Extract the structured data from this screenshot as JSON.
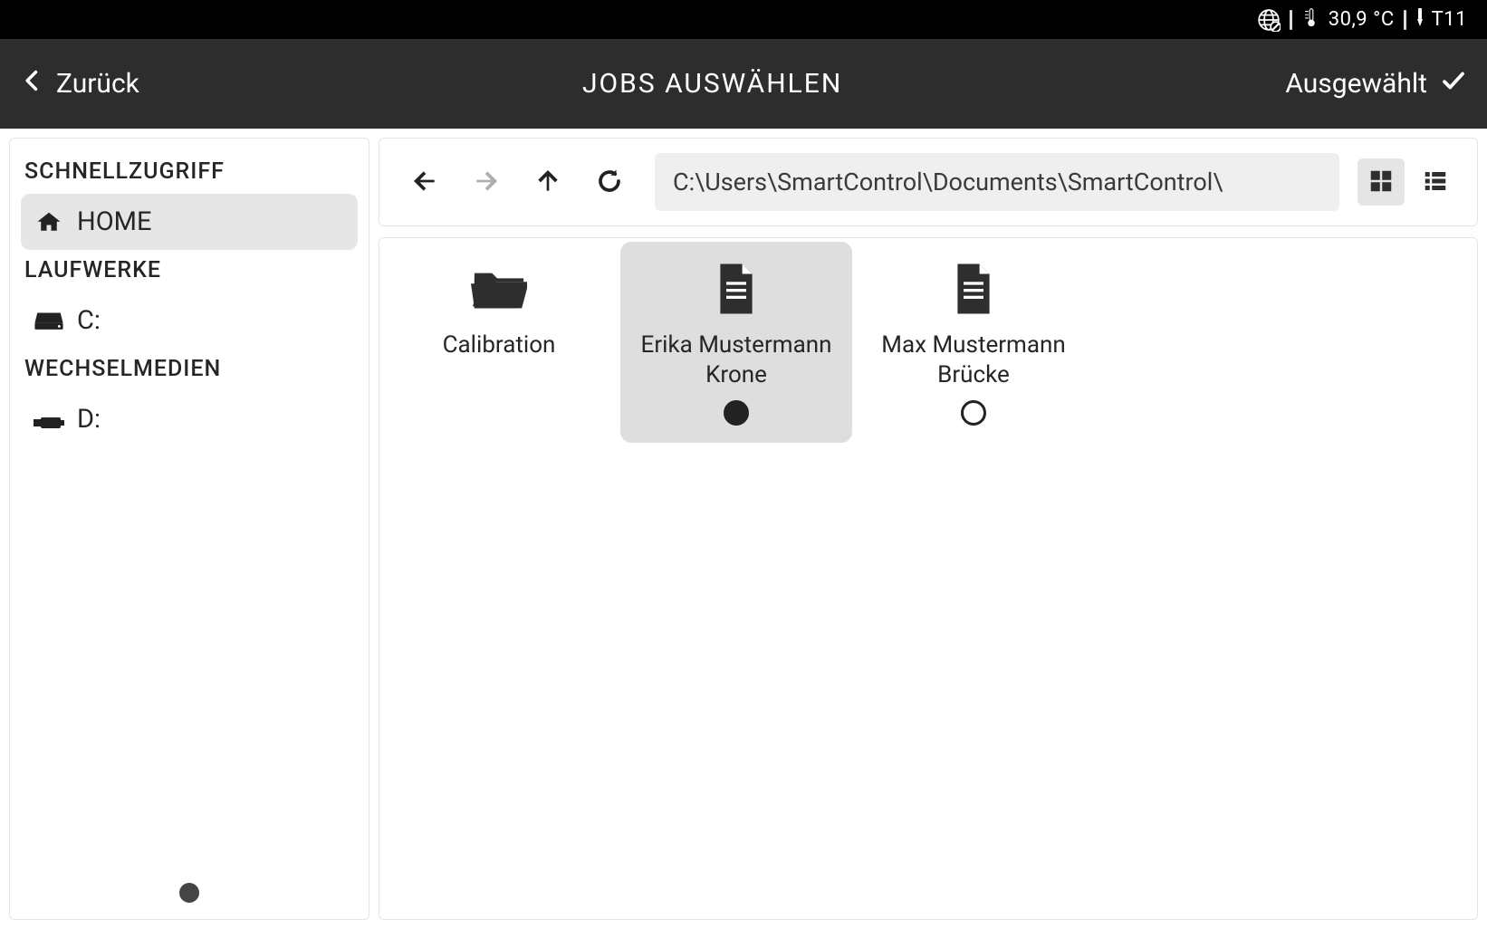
{
  "status": {
    "temperature": "30,9 °C",
    "tool": "T11"
  },
  "header": {
    "back": "Zurück",
    "title": "JOBS AUSWÄHLEN",
    "action": "Ausgewählt"
  },
  "sidebar": {
    "sections": {
      "quick_access": "SCHNELLZUGRIFF",
      "drives": "LAUFWERKE",
      "removable": "WECHSELMEDIEN"
    },
    "items": {
      "home": "HOME",
      "drive_c": "C:",
      "drive_d": "D:"
    }
  },
  "toolbar": {
    "path": "C:\\Users\\SmartControl\\Documents\\SmartControl\\"
  },
  "content": {
    "tiles": [
      {
        "type": "folder",
        "label": "Calibration",
        "selected": false,
        "selectable": false
      },
      {
        "type": "file",
        "label": "Erika Mustermann Krone",
        "selected": true,
        "selectable": true
      },
      {
        "type": "file",
        "label": "Max Mustermann Brücke",
        "selected": false,
        "selectable": true
      }
    ]
  }
}
